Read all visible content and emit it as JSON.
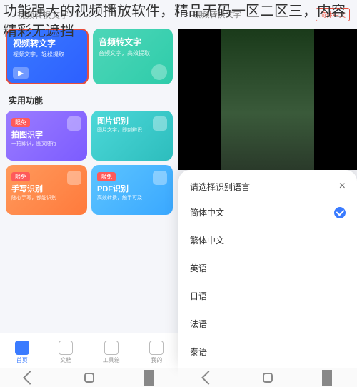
{
  "overlay": "功能强大的视频播放软件，精品无码一区二区三，内容精彩无遮挡",
  "phone1": {
    "header": "视频转换文字",
    "tabs": [
      {
        "title": "视频转文字",
        "sub": "视频文字，轻松提取"
      },
      {
        "title": "音频转文字",
        "sub": "音频文字，高效提取"
      }
    ],
    "section": "实用功能",
    "cards": [
      {
        "badge": "限免",
        "title": "拍图识字",
        "sub": "一拍即识，图文随行"
      },
      {
        "badge": "",
        "title": "图片识别",
        "sub": "图片文字，即刻辨识"
      },
      {
        "badge": "限免",
        "title": "手写识别",
        "sub": "随心手写，都能识别"
      },
      {
        "badge": "限免",
        "title": "PDF识别",
        "sub": "高效转换，触手可及"
      }
    ],
    "bottom": [
      "首页",
      "文档",
      "工具箱",
      "我的"
    ]
  },
  "phone2": {
    "header": "视频转换文字",
    "lang_btn": "简体中文",
    "sheet_title": "请选择识别语言",
    "langs": [
      "简体中文",
      "繁体中文",
      "英语",
      "日语",
      "法语",
      "泰语"
    ]
  }
}
